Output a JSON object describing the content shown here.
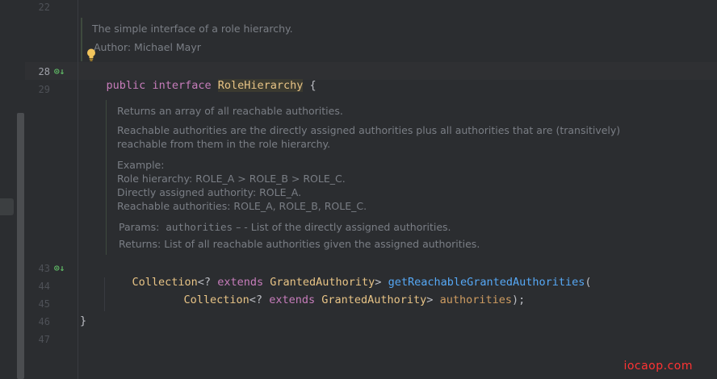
{
  "gutter": {
    "line_numbers": [
      "22",
      "28",
      "29",
      "43",
      "44",
      "45",
      "46",
      "47"
    ]
  },
  "class_doc": {
    "summary": "The simple interface of a role hierarchy.",
    "author": "Author: Michael Mayr"
  },
  "declaration": {
    "kw_public": "public",
    "kw_interface": "interface",
    "name": "RoleHierarchy",
    "brace_open": "{"
  },
  "method_doc": {
    "line1": "Returns an array of all reachable authorities.",
    "line2": "Reachable authorities are the directly assigned authorities plus all authorities that are (transitively)",
    "line3": "reachable from them in the role hierarchy.",
    "example_label": "Example:",
    "example1": "Role hierarchy: ROLE_A > ROLE_B > ROLE_C.",
    "example2": "Directly assigned authority: ROLE_A.",
    "example3": "Reachable authorities: ROLE_A, ROLE_B, ROLE_C.",
    "params_label": "Params:",
    "params_name": "authorities",
    "params_desc": " – - List of the directly assigned authorities.",
    "returns_label": "Returns:",
    "returns_desc": "List of all reachable authorities given the assigned authorities."
  },
  "method": {
    "ret_type": "Collection",
    "generic_open": "<? ",
    "kw_extends": "extends",
    "ret_elem": "GrantedAuthority",
    "generic_close": ">",
    "name": "getReachableGrantedAuthorities",
    "paren_open": "(",
    "param_type": "Collection",
    "param_elem": "GrantedAuthority",
    "param_name": "authorities",
    "param_close": ");",
    "brace_close": "}"
  },
  "watermark": "iocaop.com",
  "colors": {
    "background": "#2b2d30",
    "keyword": "#cf8e6d",
    "type": "#e8c486",
    "function": "#56a8f5",
    "doc": "#7a7e85",
    "watermark": "#ff3333"
  },
  "icons": [
    "implemented-icon",
    "lightbulb-icon"
  ]
}
